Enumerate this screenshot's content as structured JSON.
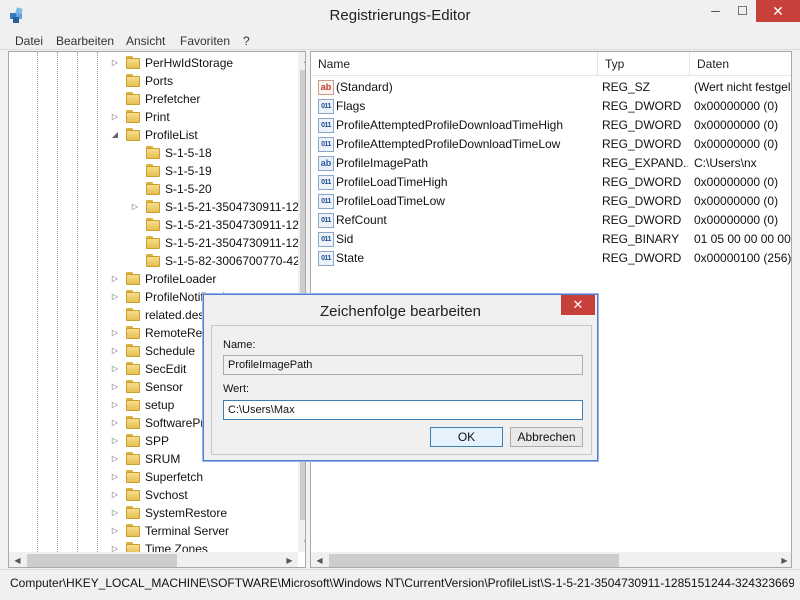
{
  "window": {
    "title": "Registrierungs-Editor",
    "min_label": "─",
    "max_label": "☐",
    "close_label": "✕"
  },
  "menu": [
    "Datei",
    "Bearbeiten",
    "Ansicht",
    "Favoriten",
    "?"
  ],
  "tree": {
    "items": [
      {
        "label": "PerHwIdStorage",
        "expander": "▷",
        "level": 0
      },
      {
        "label": "Ports",
        "expander": "",
        "level": 0
      },
      {
        "label": "Prefetcher",
        "expander": "",
        "level": 0
      },
      {
        "label": "Print",
        "expander": "▷",
        "level": 0
      },
      {
        "label": "ProfileList",
        "expander": "◢",
        "level": 0
      },
      {
        "label": "S-1-5-18",
        "expander": "",
        "level": 1
      },
      {
        "label": "S-1-5-19",
        "expander": "",
        "level": 1
      },
      {
        "label": "S-1-5-20",
        "expander": "",
        "level": 1
      },
      {
        "label": "S-1-5-21-3504730911-12",
        "expander": "▷",
        "level": 1
      },
      {
        "label": "S-1-5-21-3504730911-12",
        "expander": "",
        "level": 1
      },
      {
        "label": "S-1-5-21-3504730911-12",
        "expander": "",
        "level": 1
      },
      {
        "label": "S-1-5-82-3006700770-42",
        "expander": "",
        "level": 1
      },
      {
        "label": "ProfileLoader",
        "expander": "▷",
        "level": 0
      },
      {
        "label": "ProfileNotification",
        "expander": "▷",
        "level": 0
      },
      {
        "label": "related.desc",
        "expander": "",
        "level": 0
      },
      {
        "label": "RemoteReg",
        "expander": "▷",
        "level": 0
      },
      {
        "label": "Schedule",
        "expander": "▷",
        "level": 0
      },
      {
        "label": "SecEdit",
        "expander": "▷",
        "level": 0
      },
      {
        "label": "Sensor",
        "expander": "▷",
        "level": 0
      },
      {
        "label": "setup",
        "expander": "▷",
        "level": 0
      },
      {
        "label": "SoftwarePr",
        "expander": "▷",
        "level": 0
      },
      {
        "label": "SPP",
        "expander": "▷",
        "level": 0
      },
      {
        "label": "SRUM",
        "expander": "▷",
        "level": 0
      },
      {
        "label": "Superfetch",
        "expander": "▷",
        "level": 0
      },
      {
        "label": "Svchost",
        "expander": "▷",
        "level": 0
      },
      {
        "label": "SystemRestore",
        "expander": "▷",
        "level": 0
      },
      {
        "label": "Terminal Server",
        "expander": "▷",
        "level": 0
      },
      {
        "label": "Time Zones",
        "expander": "▷",
        "level": 0
      }
    ]
  },
  "list": {
    "columns": [
      "Name",
      "Typ",
      "Daten"
    ],
    "rows": [
      {
        "icon": "string-value-icon",
        "icon_text": "ab",
        "name": "(Standard)",
        "type": "REG_SZ",
        "data": "(Wert nicht festgel"
      },
      {
        "icon": "binary-value-icon",
        "icon_text": "011",
        "name": "Flags",
        "type": "REG_DWORD",
        "data": "0x00000000 (0)"
      },
      {
        "icon": "binary-value-icon",
        "icon_text": "011",
        "name": "ProfileAttemptedProfileDownloadTimeHigh",
        "type": "REG_DWORD",
        "data": "0x00000000 (0)"
      },
      {
        "icon": "binary-value-icon",
        "icon_text": "011",
        "name": "ProfileAttemptedProfileDownloadTimeLow",
        "type": "REG_DWORD",
        "data": "0x00000000 (0)"
      },
      {
        "icon": "expandstring-value-icon",
        "icon_text": "ab",
        "name": "ProfileImagePath",
        "type": "REG_EXPAND...",
        "data": "C:\\Users\\nx"
      },
      {
        "icon": "binary-value-icon",
        "icon_text": "011",
        "name": "ProfileLoadTimeHigh",
        "type": "REG_DWORD",
        "data": "0x00000000 (0)"
      },
      {
        "icon": "binary-value-icon",
        "icon_text": "011",
        "name": "ProfileLoadTimeLow",
        "type": "REG_DWORD",
        "data": "0x00000000 (0)"
      },
      {
        "icon": "binary-value-icon",
        "icon_text": "011",
        "name": "RefCount",
        "type": "REG_DWORD",
        "data": "0x00000000 (0)"
      },
      {
        "icon": "binary-value-icon",
        "icon_text": "011",
        "name": "Sid",
        "type": "REG_BINARY",
        "data": "01 05 00 00 00 00 0"
      },
      {
        "icon": "binary-value-icon",
        "icon_text": "011",
        "name": "State",
        "type": "REG_DWORD",
        "data": "0x00000100 (256)"
      }
    ]
  },
  "status": {
    "path": "Computer\\HKEY_LOCAL_MACHINE\\SOFTWARE\\Microsoft\\Windows NT\\CurrentVersion\\ProfileList\\S-1-5-21-3504730911-1285151244-324323669"
  },
  "dialog": {
    "title": "Zeichenfolge bearbeiten",
    "close_label": "✕",
    "name_label": "Name:",
    "name_value": "ProfileImagePath",
    "value_label": "Wert:",
    "value_value": "C:\\Users\\Max",
    "ok_label": "OK",
    "cancel_label": "Abbrechen"
  },
  "colors": {
    "close_red": "#c7413a",
    "dialog_border": "#4f7bd0",
    "folder_yellow": "#e6bf52"
  }
}
